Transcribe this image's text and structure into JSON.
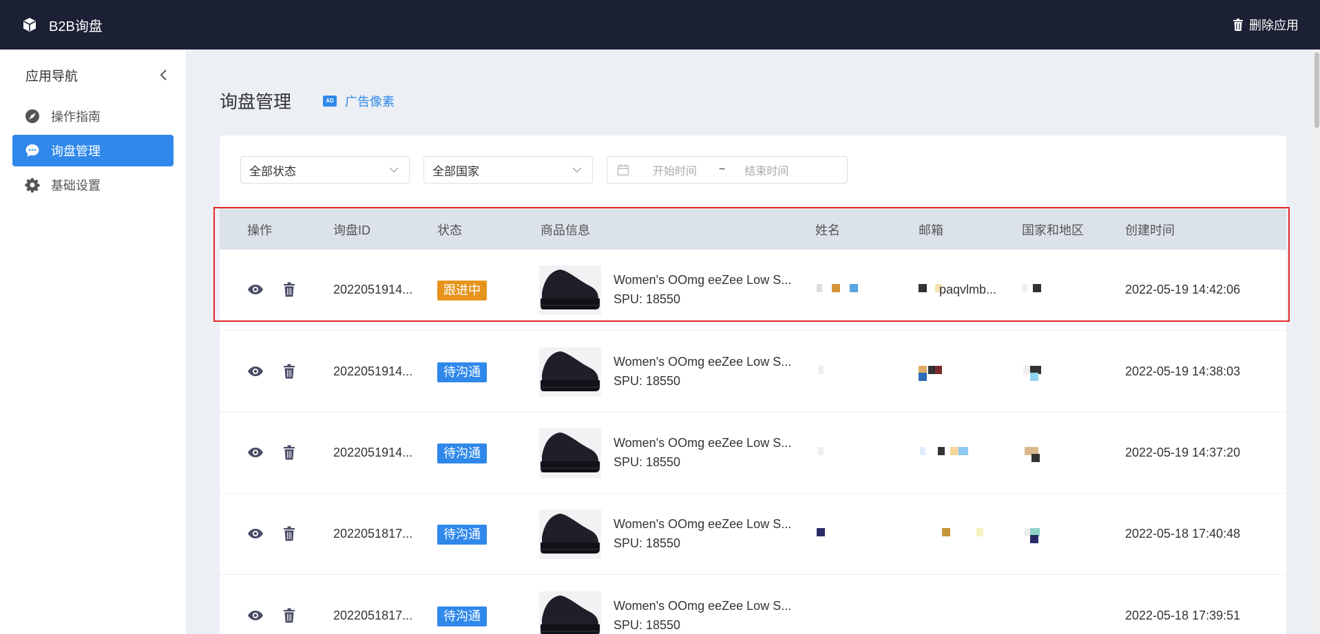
{
  "topbar": {
    "app_title": "B2B询盘",
    "delete_app_label": "删除应用"
  },
  "sidebar": {
    "title": "应用导航",
    "items": [
      {
        "label": "操作指南",
        "icon": "compass-icon",
        "active": false
      },
      {
        "label": "询盘管理",
        "icon": "chat-icon",
        "active": true
      },
      {
        "label": "基础设置",
        "icon": "gear-icon",
        "active": false
      }
    ]
  },
  "page": {
    "title": "询盘管理",
    "ad_link_label": "广告像素",
    "ad_badge_text": "AD"
  },
  "filters": {
    "status_value": "全部状态",
    "country_value": "全部国家",
    "start_placeholder": "开始时间",
    "end_placeholder": "结束时间",
    "range_separator": "~"
  },
  "table": {
    "columns": [
      "操作",
      "询盘ID",
      "状态",
      "商品信息",
      "姓名",
      "邮箱",
      "国家和地区",
      "创建时间"
    ],
    "rows": [
      {
        "id": "2022051914...",
        "status": "跟进中",
        "status_color": "#e6941c",
        "product": "Women's OOmg eeZee Low S...",
        "spu": "SPU: 18550",
        "name": "",
        "email": "paqvlmb...",
        "country": "",
        "created": "2022-05-19 14:42:06"
      },
      {
        "id": "2022051914...",
        "status": "待沟通",
        "status_color": "#2f88ea",
        "product": "Women's OOmg eeZee Low S...",
        "spu": "SPU: 18550",
        "name": "",
        "email": "",
        "country": "",
        "created": "2022-05-19 14:38:03"
      },
      {
        "id": "2022051914...",
        "status": "待沟通",
        "status_color": "#2f88ea",
        "product": "Women's OOmg eeZee Low S...",
        "spu": "SPU: 18550",
        "name": "",
        "email": "",
        "country": "",
        "created": "2022-05-19 14:37:20"
      },
      {
        "id": "2022051817...",
        "status": "待沟通",
        "status_color": "#2f88ea",
        "product": "Women's OOmg eeZee Low S...",
        "spu": "SPU: 18550",
        "name": "",
        "email": "",
        "country": "",
        "created": "2022-05-18 17:40:48"
      },
      {
        "id": "2022051817...",
        "status": "待沟通",
        "status_color": "#2f88ea",
        "product": "Women's OOmg eeZee Low S...",
        "spu": "SPU: 18550",
        "name": "",
        "email": "",
        "country": "",
        "created": "2022-05-18 17:39:51"
      }
    ]
  },
  "colors": {
    "accent": "#2f88ea",
    "topbar": "#1b2035",
    "highlight": "#e32626"
  }
}
